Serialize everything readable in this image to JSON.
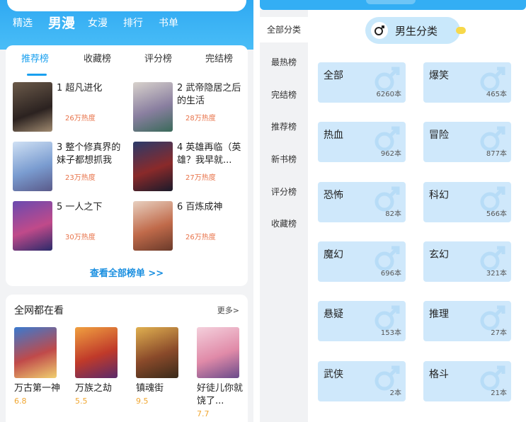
{
  "left": {
    "top_tabs": [
      "精选",
      "男漫",
      "女漫",
      "排行",
      "书单"
    ],
    "rank_tabs": [
      "推荐榜",
      "收藏榜",
      "评分榜",
      "完结榜"
    ],
    "rank_items": [
      {
        "num": "1",
        "title": "超凡进化",
        "heat": "26万热度"
      },
      {
        "num": "2",
        "title": "武帝隐居之后的生活",
        "heat": "28万热度"
      },
      {
        "num": "3",
        "title": "整个修真界的妹子都想抓我",
        "heat": "23万热度"
      },
      {
        "num": "4",
        "title": "英雄再临（英雄？我早就...",
        "heat": "27万热度"
      },
      {
        "num": "5",
        "title": "一人之下",
        "heat": "30万热度"
      },
      {
        "num": "6",
        "title": "百炼成神",
        "heat": "26万热度"
      }
    ],
    "see_all": "查看全部榜单 >>",
    "watch": {
      "title": "全网都在看",
      "more": "更多>",
      "items": [
        {
          "name": "万古第一神",
          "score": "6.8"
        },
        {
          "name": "万族之劫",
          "score": "5.5"
        },
        {
          "name": "镇魂街",
          "score": "9.5"
        },
        {
          "name": "好徒儿你就饶了...",
          "score": "7.7"
        }
      ]
    }
  },
  "right": {
    "side_nav": [
      "全部分类",
      "最热榜",
      "完结榜",
      "推荐榜",
      "新书榜",
      "评分榜",
      "收藏榜"
    ],
    "gender_label": "男生分类",
    "categories": [
      {
        "name": "全部",
        "count": "6260本"
      },
      {
        "name": "爆笑",
        "count": "465本"
      },
      {
        "name": "热血",
        "count": "962本"
      },
      {
        "name": "冒险",
        "count": "877本"
      },
      {
        "name": "恐怖",
        "count": "82本"
      },
      {
        "name": "科幻",
        "count": "566本"
      },
      {
        "name": "魔幻",
        "count": "696本"
      },
      {
        "name": "玄幻",
        "count": "321本"
      },
      {
        "name": "悬疑",
        "count": "153本"
      },
      {
        "name": "推理",
        "count": "27本"
      },
      {
        "name": "武侠",
        "count": "2本"
      },
      {
        "name": "格斗",
        "count": "21本"
      }
    ]
  },
  "colors": {
    "accent": "#1aa0ef",
    "header_blue": "#2fa9f2",
    "heat_orange": "#e8734a",
    "score_gold": "#f0a630",
    "category_card": "#cfe8fb"
  }
}
